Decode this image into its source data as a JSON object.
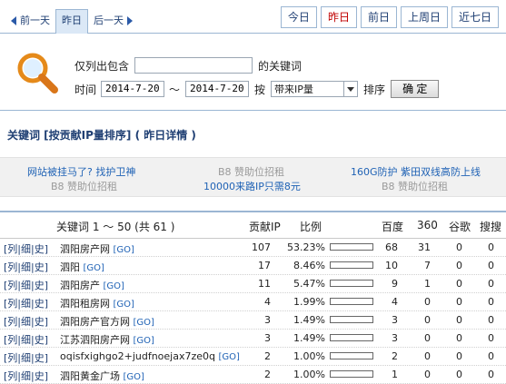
{
  "nav": {
    "prev_label": "前一天",
    "current_label": "昨日",
    "next_label": "后一天",
    "quick": [
      "今日",
      "昨日",
      "前日",
      "上周日",
      "近七日"
    ],
    "active_quick_index": 1
  },
  "filter": {
    "only_list_label": "仅列出包含",
    "keyword_suffix": "的关键词",
    "keyword_value": "",
    "time_label": "时间",
    "date_from": "2014-7-20",
    "range_sep": "～",
    "date_to": "2014-7-20",
    "by_label": "按",
    "sort_field": "带来IP量",
    "sort_label": "排序",
    "ok_label": "确 定"
  },
  "section_title": "关键词 [按贡献IP量排序] ( 昨日详情 )",
  "ads": [
    {
      "text": "网站被挂马了? 找护卫神",
      "type": "link"
    },
    {
      "text": "B8 赞助位招租",
      "type": "muted"
    },
    {
      "text": "160G防护 紫田双线高防上线",
      "type": "link"
    },
    {
      "text": "B8 赞助位招租",
      "type": "muted"
    },
    {
      "text": "10000来路IP只需8元",
      "type": "link"
    },
    {
      "text": "B8 赞助位招租",
      "type": "muted"
    }
  ],
  "table": {
    "headers": {
      "keyword": "关键词 1 ～ 50 (共 61 )",
      "ip": "贡献IP",
      "ratio": "比例",
      "baidu": "百度",
      "s360": "360",
      "google": "谷歌",
      "sogou": "搜搜"
    },
    "row_links": [
      "[列",
      "|细",
      "|史]"
    ],
    "go_label": "[GO]",
    "rows": [
      {
        "keyword": "泗阳房产网",
        "ip": "107",
        "ratio": "53.23%",
        "bar": 0.9,
        "baidu": "68",
        "s360": "31",
        "google": "0",
        "sogou": "0"
      },
      {
        "keyword": "泗阳",
        "ip": "17",
        "ratio": "8.46%",
        "bar": 0.16,
        "baidu": "10",
        "s360": "7",
        "google": "0",
        "sogou": "0"
      },
      {
        "keyword": "泗阳房产",
        "ip": "11",
        "ratio": "5.47%",
        "bar": 0.11,
        "baidu": "9",
        "s360": "1",
        "google": "0",
        "sogou": "0"
      },
      {
        "keyword": "泗阳租房网",
        "ip": "4",
        "ratio": "1.99%",
        "bar": 0.05,
        "baidu": "4",
        "s360": "0",
        "google": "0",
        "sogou": "0"
      },
      {
        "keyword": "泗阳房产官方网",
        "ip": "3",
        "ratio": "1.49%",
        "bar": 0.04,
        "baidu": "3",
        "s360": "0",
        "google": "0",
        "sogou": "0"
      },
      {
        "keyword": "江苏泗阳房产网",
        "ip": "3",
        "ratio": "1.49%",
        "bar": 0.04,
        "baidu": "3",
        "s360": "0",
        "google": "0",
        "sogou": "0"
      },
      {
        "keyword": "oqisfxighgo2+judfnoejax7ze0q",
        "ip": "2",
        "ratio": "1.00%",
        "bar": 0.03,
        "baidu": "2",
        "s360": "0",
        "google": "0",
        "sogou": "0"
      },
      {
        "keyword": "泗阳黄金广场",
        "ip": "2",
        "ratio": "1.00%",
        "bar": 0.03,
        "baidu": "1",
        "s360": "0",
        "google": "0",
        "sogou": "0"
      }
    ]
  }
}
